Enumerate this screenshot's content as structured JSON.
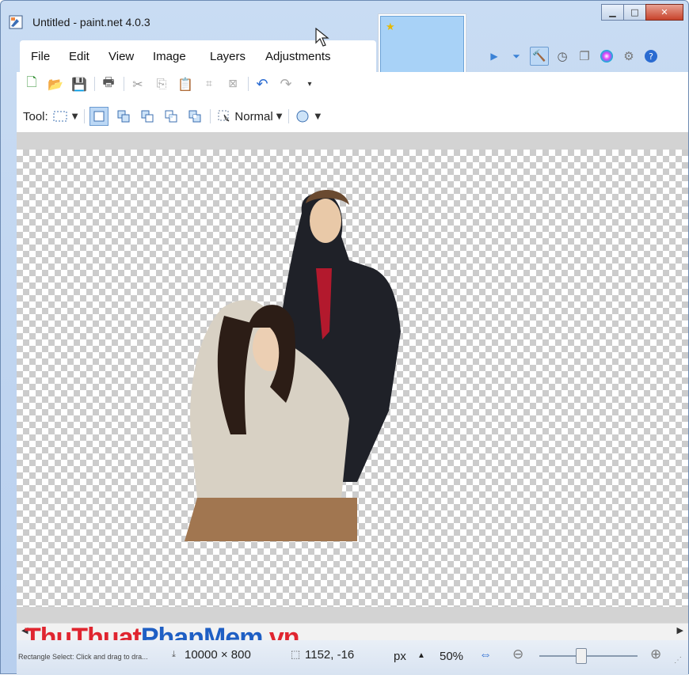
{
  "window": {
    "title": "Untitled - paint.net 4.0.3"
  },
  "menu": {
    "items": [
      "File",
      "Edit",
      "View",
      "Image",
      "Layers",
      "Adjustments"
    ]
  },
  "toolbar": {
    "tool_label": "Tool:",
    "blend_mode": "Normal"
  },
  "status": {
    "hint": "Rectangle Select: Click and drag to dra...",
    "image_size": "10000 × 800",
    "cursor_position": "1152, -16",
    "unit": "px",
    "zoom": "50%"
  },
  "watermark": {
    "part1": "ThuThuat",
    "part2": "PhanMem",
    "part3": ".vn"
  },
  "colors": {
    "accent": "#bcd8f5",
    "titlebar": "#c9dcf3",
    "close": "#c8432b"
  }
}
